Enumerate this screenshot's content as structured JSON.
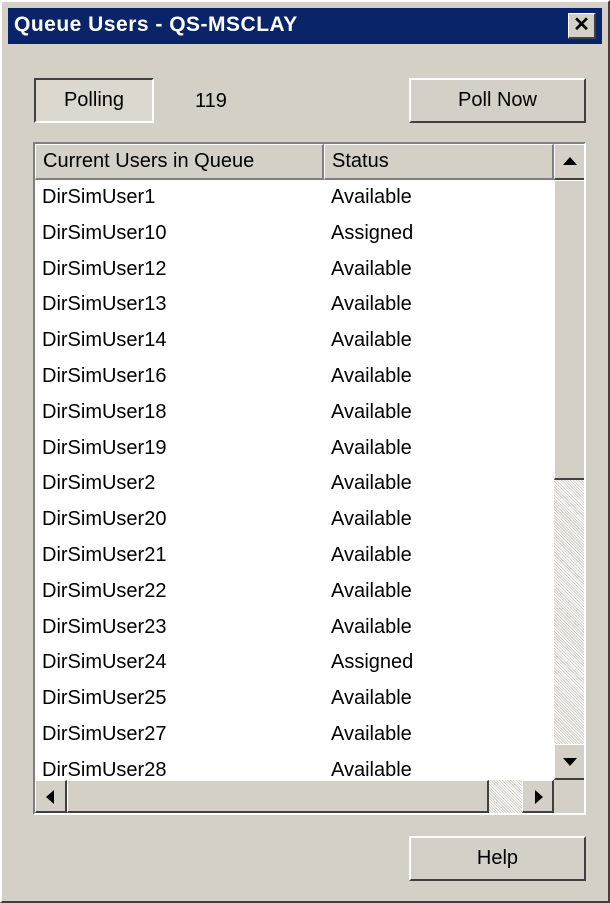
{
  "window": {
    "title": "Queue Users - QS-MSCLAY",
    "close_glyph": "✕"
  },
  "toolbar": {
    "polling_label": "Polling",
    "poll_count": "119",
    "poll_now_label": "Poll Now"
  },
  "list": {
    "columns": [
      "Current Users in Queue",
      "Status"
    ],
    "rows": [
      {
        "user": "DirSimUser1",
        "status": "Available"
      },
      {
        "user": "DirSimUser10",
        "status": "Assigned"
      },
      {
        "user": "DirSimUser12",
        "status": "Available"
      },
      {
        "user": "DirSimUser13",
        "status": "Available"
      },
      {
        "user": "DirSimUser14",
        "status": "Available"
      },
      {
        "user": "DirSimUser16",
        "status": "Available"
      },
      {
        "user": "DirSimUser18",
        "status": "Available"
      },
      {
        "user": "DirSimUser19",
        "status": "Available"
      },
      {
        "user": "DirSimUser2",
        "status": "Available"
      },
      {
        "user": "DirSimUser20",
        "status": "Available"
      },
      {
        "user": "DirSimUser21",
        "status": "Available"
      },
      {
        "user": "DirSimUser22",
        "status": "Available"
      },
      {
        "user": "DirSimUser23",
        "status": "Available"
      },
      {
        "user": "DirSimUser24",
        "status": "Assigned"
      },
      {
        "user": "DirSimUser25",
        "status": "Available"
      },
      {
        "user": "DirSimUser27",
        "status": "Available"
      },
      {
        "user": "DirSimUser28",
        "status": "Available"
      }
    ]
  },
  "footer": {
    "help_label": "Help"
  },
  "icons": {
    "close": "close-icon",
    "scroll_up": "up-arrow-icon",
    "scroll_down": "down-arrow-icon",
    "scroll_left": "left-arrow-icon",
    "scroll_right": "right-arrow-icon"
  },
  "colors": {
    "titlebar": "#0a246a",
    "face": "#d4d0c8"
  }
}
